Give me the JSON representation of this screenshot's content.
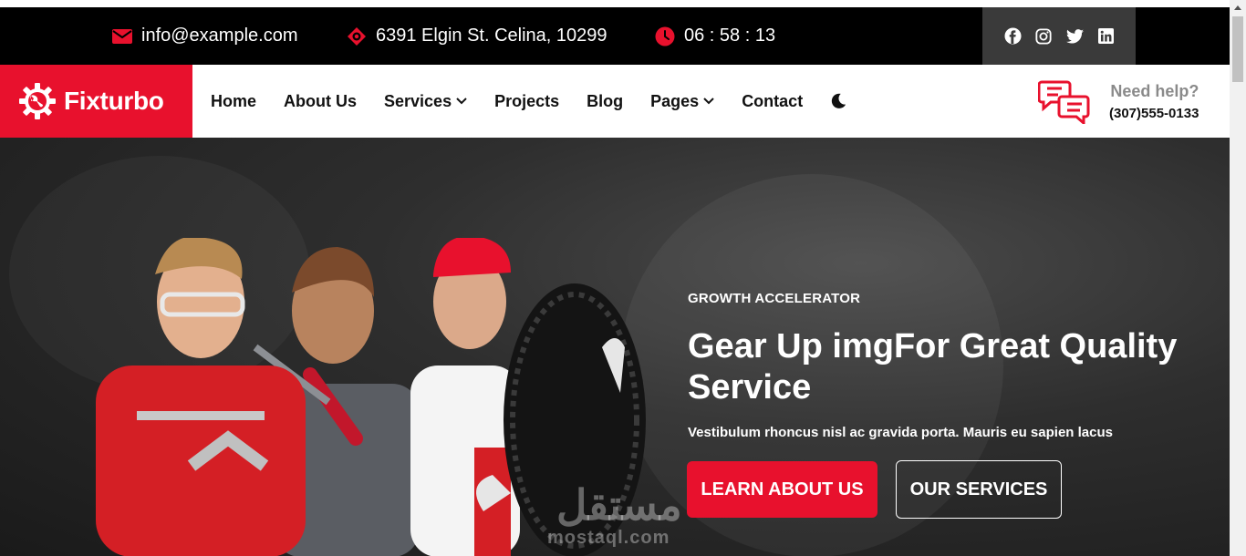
{
  "topbar": {
    "email": "info@example.com",
    "address": "6391 Elgin St. Celina, 10299",
    "time": "06 : 58 : 13",
    "social_icons": [
      "facebook-icon",
      "instagram-icon",
      "twitter-icon",
      "linkedin-icon"
    ]
  },
  "brand": {
    "name": "Fixturbo",
    "accent": "#e8112d"
  },
  "nav": {
    "items": [
      {
        "label": "Home",
        "has_dropdown": false
      },
      {
        "label": "About Us",
        "has_dropdown": false
      },
      {
        "label": "Services",
        "has_dropdown": true
      },
      {
        "label": "Projects",
        "has_dropdown": false
      },
      {
        "label": "Blog",
        "has_dropdown": false
      },
      {
        "label": "Pages",
        "has_dropdown": true
      },
      {
        "label": "Contact",
        "has_dropdown": false
      }
    ],
    "theme_toggle_icon": "moon-icon"
  },
  "help": {
    "title": "Need help?",
    "phone": "(307)555-0133",
    "icon": "chat-bubbles-icon"
  },
  "hero": {
    "eyebrow": "GROWTH ACCELERATOR",
    "title": "Gear Up imgFor Great Quality Service",
    "subtitle": "Vestibulum rhoncus nisl ac gravida porta. Mauris eu sapien lacus",
    "primary_button": "LEARN ABOUT US",
    "secondary_button": "OUR SERVICES"
  },
  "watermark": {
    "arabic": "مستقل",
    "latin": "mostaql.com"
  }
}
